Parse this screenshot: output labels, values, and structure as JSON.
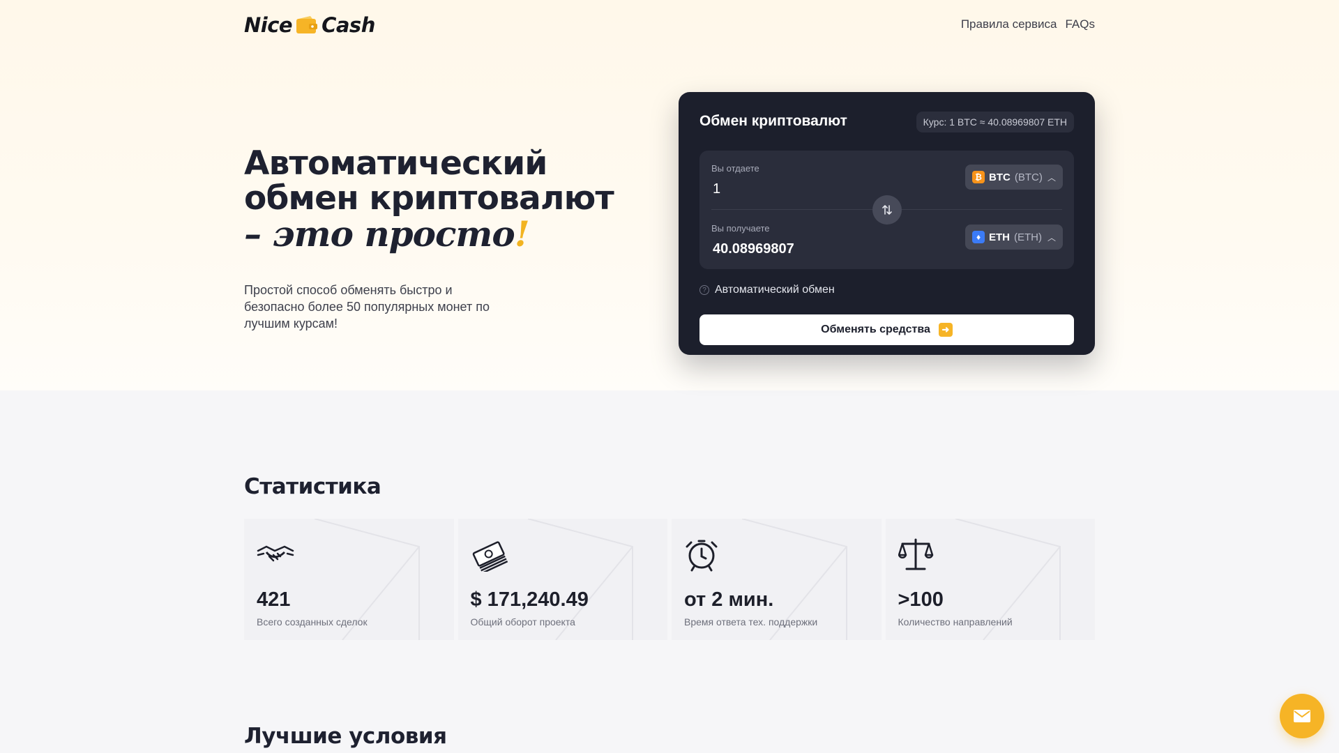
{
  "logo": {
    "left": "Nice",
    "right": "Cash"
  },
  "nav": {
    "rules": "Правила сервиса",
    "faqs": "FAQs"
  },
  "hero": {
    "title_line1": "Автоматический",
    "title_line2": "обмен криптовалют",
    "script": "– это просто",
    "script_excl": "!",
    "description": "Простой способ обменять быстро и безопасно более 50 популярных монет по лучшим курсам!"
  },
  "exchange": {
    "title": "Обмен криптовалют",
    "rate": "Курс: 1  BTC ≈ 40.08969807 ETH",
    "give": {
      "label": "Вы отдаете",
      "value": "1",
      "currency_code": "BTC",
      "currency_sub": "(BTC)"
    },
    "get": {
      "label": "Вы получаете",
      "value": "40.08969807",
      "currency_code": "ETH",
      "currency_sub": "(ETH)"
    },
    "auto_label": "Автоматический обмен",
    "submit": "Обменять средства"
  },
  "stats": {
    "title": "Статистика",
    "items": [
      {
        "icon": "handshake-icon",
        "value": "421",
        "label": "Всего созданных сделок"
      },
      {
        "icon": "money-stack-icon",
        "value": "$ 171,240.49",
        "label": "Общий оборот проекта"
      },
      {
        "icon": "alarm-clock-icon",
        "value": "от 2 мин.",
        "label": "Время ответа тех. поддержки"
      },
      {
        "icon": "scales-icon",
        "value": ">100",
        "label": "Количество направлений"
      }
    ]
  },
  "best": {
    "title": "Лучшие условия"
  },
  "colors": {
    "accent": "#f6b426",
    "card": "#1c1f2c",
    "btc": "#f7931a",
    "eth": "#3b7bf6"
  }
}
